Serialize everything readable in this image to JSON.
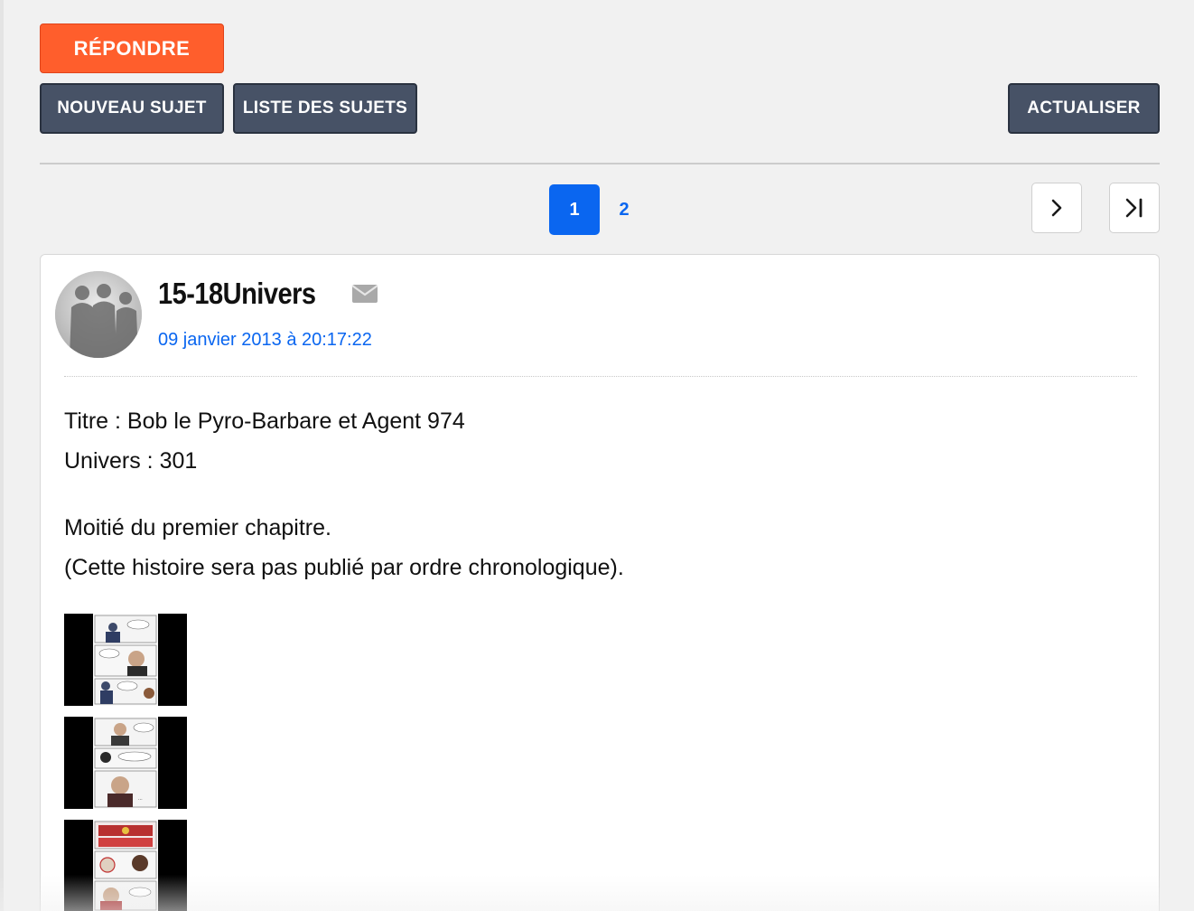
{
  "toolbar": {
    "reply_label": "RÉPONDRE",
    "new_topic_label": "NOUVEAU SUJET",
    "topic_list_label": "LISTE DES SUJETS",
    "refresh_label": "ACTUALISER"
  },
  "pagination": {
    "current_page": "1",
    "other_page": "2",
    "next_icon": "chevron-right-icon",
    "last_icon": "skip-to-last-icon"
  },
  "post": {
    "author": "15-18Univers",
    "date": "09 janvier 2013 à 20:17:22",
    "mail_icon": "envelope-icon",
    "lines": {
      "title": "Titre : Bob le Pyro-Barbare et Agent 974",
      "universe": "Univers : 301",
      "chapter": "Moitié du premier chapitre.",
      "note": "(Cette histoire sera pas publié par ordre chronologique)."
    },
    "images": [
      "comic-page-thumbnail-1",
      "comic-page-thumbnail-2",
      "comic-page-thumbnail-3"
    ]
  },
  "colors": {
    "accent_orange": "#ff5e2c",
    "button_dark": "#475266",
    "link_blue": "#0a66f0",
    "page_bg": "#f1f1f1"
  }
}
